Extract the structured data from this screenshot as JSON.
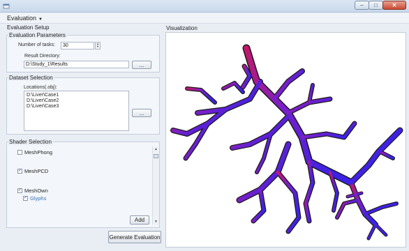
{
  "menu": {
    "evaluation_label": "Evaluation"
  },
  "left": {
    "title": "Evaluation Setup",
    "params": {
      "title": "Evaluation Parameters",
      "tasks_label": "Number of tasks:",
      "tasks_value": "30",
      "result_label": "Result Directory:",
      "result_value": "D:\\Study_1\\Results",
      "browse_label": "..."
    },
    "dataset": {
      "title": "Dataset Selection",
      "locations_label": "Locations(.obj):",
      "locations": [
        "D:\\Liver\\Case1",
        "D:\\Liver\\Case2",
        "D:\\Liver\\Case3"
      ],
      "browse_label": "..."
    },
    "shader": {
      "title": "Shader Selection",
      "items": [
        {
          "label": "MeshPhong",
          "checked": false
        },
        {
          "label": "MeshPCD",
          "checked": true
        },
        {
          "label": "MeshOwn",
          "checked": true
        },
        {
          "label": "Glyphs",
          "checked": true
        }
      ],
      "add_label": "Add"
    },
    "generate_label": "Generate Evaluation"
  },
  "right": {
    "title": "Visualization"
  },
  "colors": {
    "magenta": "#c2186b",
    "purple": "#7a1fc8",
    "blue": "#3b22e6",
    "outline": "#1a1a1a"
  },
  "icons": {
    "app": "app-icon",
    "minimize": "minimize-icon",
    "maximize": "maximize-icon",
    "close": "close-icon",
    "menu_caret": "caret-down-icon",
    "check": "checkmark-icon"
  }
}
